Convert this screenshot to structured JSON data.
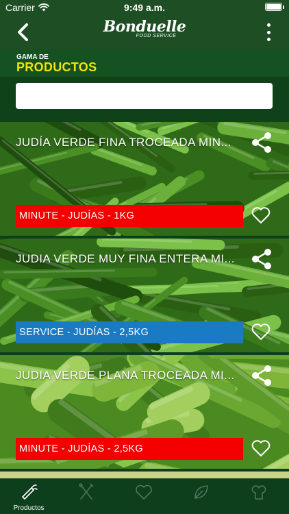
{
  "status_bar": {
    "carrier": "Carrier",
    "time": "9:49 a.m."
  },
  "header": {
    "logo_main": "Bonduelle",
    "logo_sub": "FOOD SERVICE",
    "back_icon": "chevron-left-icon",
    "menu_icon": "more-vertical-icon"
  },
  "section": {
    "small": "GAMA DE",
    "big": "PRODUCTOS"
  },
  "search": {
    "value": "",
    "placeholder": ""
  },
  "products": [
    {
      "title": "JUDÍA VERDE FINA TROCEADA MIN...",
      "tag": "MINUTE - JUDÍAS - 1KG",
      "tag_color": "#f40000"
    },
    {
      "title": "JUDIA VERDE MUY FINA ENTERA MI...",
      "tag": "SERVICE - JUDÍAS - 2,5KG",
      "tag_color": "#1a7bc4"
    },
    {
      "title": "JUDIA VERDE PLANA TROCEADA MI...",
      "tag": "MINUTE - JUDÍAS - 2,5KG",
      "tag_color": "#f40000"
    }
  ],
  "tabs": [
    {
      "label": "Productos",
      "icon": "carrot-icon",
      "active": true
    },
    {
      "label": "",
      "icon": "utensils-icon",
      "active": false
    },
    {
      "label": "",
      "icon": "heart-icon",
      "active": false
    },
    {
      "label": "",
      "icon": "leaf-icon",
      "active": false
    },
    {
      "label": "",
      "icon": "chef-icon",
      "active": false
    }
  ],
  "colors": {
    "header": "#1e4f24",
    "accent_yellow": "#f2e500",
    "minute_red": "#f40000",
    "service_blue": "#1a7bc4"
  }
}
